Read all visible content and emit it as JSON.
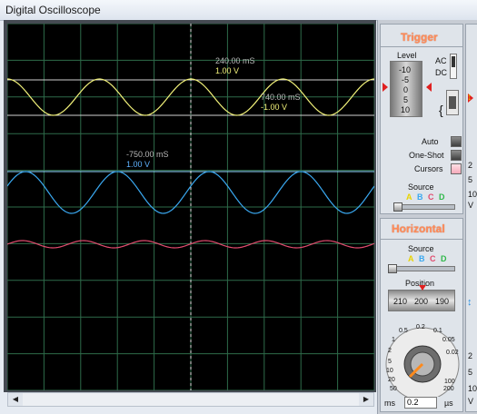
{
  "window": {
    "title": "Digital Oscilloscope"
  },
  "screen": {
    "cursors": [
      {
        "time": "240.00 mS",
        "value": "1.00 V",
        "time_color": "#b8b8b8",
        "value_color": "#f2f27a"
      },
      {
        "time": "740.00 mS",
        "value": "-1.00 V",
        "time_color": "#b8b8b8",
        "value_color": "#f2f27a"
      },
      {
        "time": "-750.00 mS",
        "value": "1.00 V",
        "time_color": "#b8b8b8",
        "value_color": "#5fb4ff"
      }
    ],
    "traces": [
      {
        "name": "A",
        "color": "#f2f27a"
      },
      {
        "name": "B",
        "color": "#3aa8f0"
      },
      {
        "name": "C",
        "color": "#e04b6e"
      }
    ],
    "grid_color": "#2e6b4a"
  },
  "scrollbar": {
    "left_arrow": "◀",
    "right_arrow": "▶"
  },
  "trigger": {
    "title": "Trigger",
    "level_label": "Level",
    "level_ticks": [
      "-10",
      "-5",
      "0",
      "5",
      "10"
    ],
    "ac_label": "AC",
    "dc_label": "DC",
    "auto_label": "Auto",
    "one_shot_label": "One-Shot",
    "cursors_label": "Cursors",
    "source_label": "Source",
    "source_letters": [
      "A",
      "B",
      "C",
      "D"
    ]
  },
  "horizontal": {
    "title": "Horizontal",
    "source_label": "Source",
    "source_letters": [
      "A",
      "B",
      "C",
      "D"
    ],
    "position_label": "Position",
    "position_ticks": [
      "210",
      "200",
      "190"
    ],
    "dial_labels": [
      "0.2",
      "0.1",
      "0.05",
      "0.02",
      "0.5",
      "1",
      "2",
      "5",
      "10",
      "20",
      "50",
      "100",
      "200"
    ],
    "unit_left": "ms",
    "unit_right": "µs",
    "value": "0.2"
  },
  "source_colors": {
    "A": "#e8d400",
    "B": "#3aa8f0",
    "C": "#e04b6e",
    "D": "#2fb84a"
  },
  "side_panel_partial": {
    "channel_ticks": [
      "2",
      "5",
      "10",
      "2",
      "5",
      "10"
    ],
    "channel_unit": "V"
  }
}
